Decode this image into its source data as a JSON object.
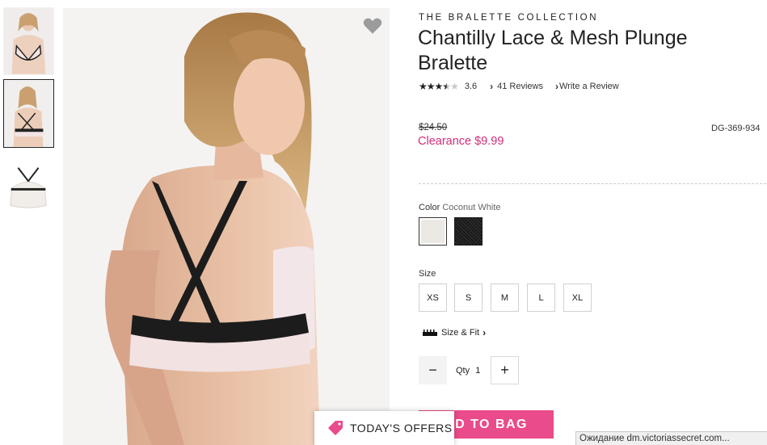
{
  "collection": "THE BRALETTE COLLECTION",
  "title": "Chantilly Lace & Mesh Plunge Bralette",
  "rating": {
    "value": "3.6",
    "stars": 3.6,
    "max": 5,
    "reviews": "41 Reviews",
    "write": "Write a Review"
  },
  "price": {
    "original": "$24.50",
    "sale": "Clearance $9.99",
    "sku": "DG-369-934"
  },
  "color": {
    "label": "Color",
    "selected": "Coconut White",
    "swatches": [
      "coconut-white",
      "black"
    ]
  },
  "size": {
    "label": "Size",
    "options": [
      "XS",
      "S",
      "M",
      "L",
      "XL"
    ],
    "fit_link": "Size & Fit"
  },
  "quantity": {
    "label": "Qty",
    "value": "1",
    "minus": "−",
    "plus": "+"
  },
  "add_to_bag": "ADD TO BAG",
  "offers": "TODAY'S OFFERS",
  "status_bar": "Ожидание dm.victoriassecret.com...",
  "colors": {
    "accent": "#ea4b8a",
    "sale": "#d12d7a"
  }
}
